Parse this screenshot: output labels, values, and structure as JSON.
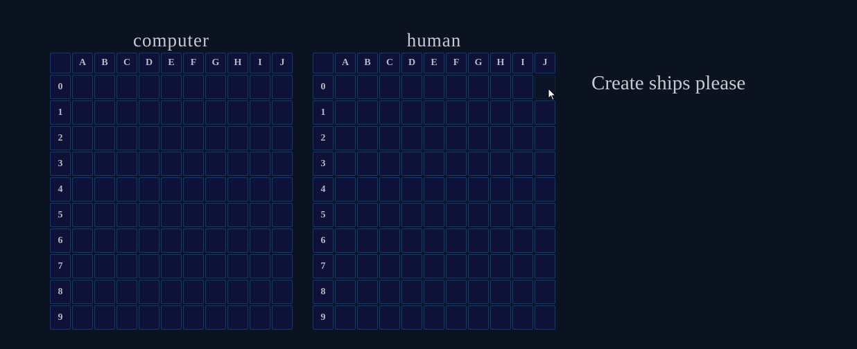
{
  "boards": [
    {
      "id": "computer",
      "title": "computer"
    },
    {
      "id": "human",
      "title": "human",
      "hover_cell": "J0"
    }
  ],
  "columns": [
    "A",
    "B",
    "C",
    "D",
    "E",
    "F",
    "G",
    "H",
    "I",
    "J"
  ],
  "rows": [
    "0",
    "1",
    "2",
    "3",
    "4",
    "5",
    "6",
    "7",
    "8",
    "9"
  ],
  "status_message": "Create ships please",
  "colors": {
    "background": "#0b1220",
    "cell": "#0e1238",
    "cell_border": "#0c3c78",
    "text": "#c8c8d0"
  }
}
